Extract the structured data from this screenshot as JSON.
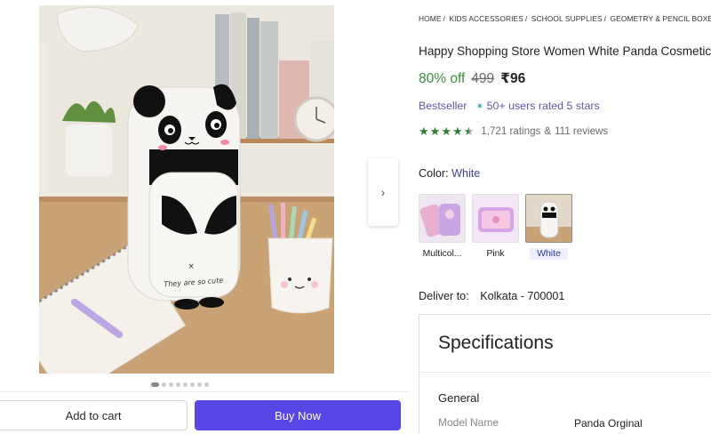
{
  "breadcrumb": [
    "HOME",
    "KIDS ACCESSORIES",
    "SCHOOL SUPPLIES",
    "GEOMETRY & PENCIL BOXES"
  ],
  "breadcrumb_separator": "/",
  "product": {
    "title": "Happy Shopping Store Women White Panda Cosmetic Pouch",
    "discount": "80% off",
    "mrp": "499",
    "price": "₹96",
    "bestseller": "Bestseller",
    "star_badge_text": "50+ users rated 5 stars",
    "rating_value": 4.5,
    "ratings": "1,721 ratings",
    "reviews_sep": "&",
    "reviews": "111 reviews"
  },
  "color": {
    "label": "Color:",
    "selected": "White",
    "options": [
      {
        "label": "Multicol...",
        "selected": false
      },
      {
        "label": "Pink",
        "selected": false
      },
      {
        "label": "White",
        "selected": true
      }
    ]
  },
  "delivery": {
    "label": "Deliver to:",
    "location": "Kolkata - 700001"
  },
  "specifications": {
    "title": "Specifications",
    "group": "General",
    "rows": [
      {
        "key": "Model Name",
        "value": "Panda Orginal"
      }
    ]
  },
  "gallery": {
    "image_print": "They are so cute",
    "dot_count": 8,
    "active_dot": 0,
    "next_icon": "chevron-right-icon"
  },
  "actions": {
    "add_to_cart": "Add to cart",
    "buy_now": "Buy Now"
  },
  "colors": {
    "accent": "#5747e6",
    "discount_green": "#388e3c",
    "badge_text": "#5a5aa8",
    "star_green": "#2e7d32"
  }
}
